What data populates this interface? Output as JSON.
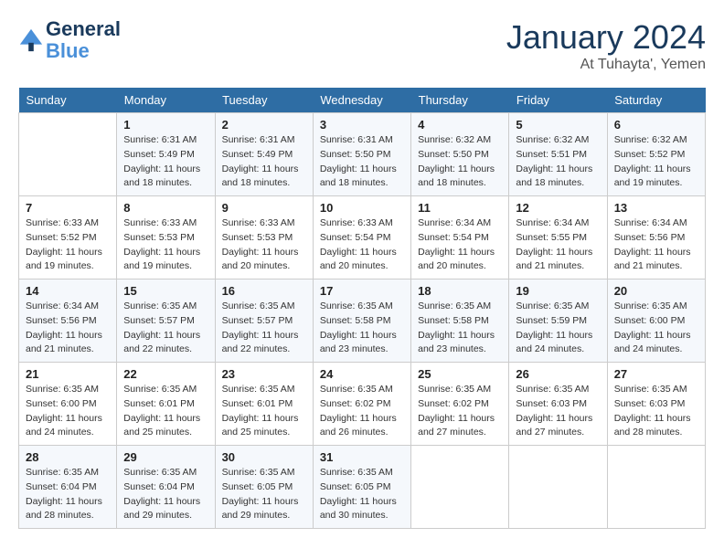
{
  "header": {
    "logo_line1": "General",
    "logo_line2": "Blue",
    "month": "January 2024",
    "location": "At Tuhayta', Yemen"
  },
  "weekdays": [
    "Sunday",
    "Monday",
    "Tuesday",
    "Wednesday",
    "Thursday",
    "Friday",
    "Saturday"
  ],
  "weeks": [
    [
      {
        "day": "",
        "info": ""
      },
      {
        "day": "1",
        "info": "Sunrise: 6:31 AM\nSunset: 5:49 PM\nDaylight: 11 hours\nand 18 minutes."
      },
      {
        "day": "2",
        "info": "Sunrise: 6:31 AM\nSunset: 5:49 PM\nDaylight: 11 hours\nand 18 minutes."
      },
      {
        "day": "3",
        "info": "Sunrise: 6:31 AM\nSunset: 5:50 PM\nDaylight: 11 hours\nand 18 minutes."
      },
      {
        "day": "4",
        "info": "Sunrise: 6:32 AM\nSunset: 5:50 PM\nDaylight: 11 hours\nand 18 minutes."
      },
      {
        "day": "5",
        "info": "Sunrise: 6:32 AM\nSunset: 5:51 PM\nDaylight: 11 hours\nand 18 minutes."
      },
      {
        "day": "6",
        "info": "Sunrise: 6:32 AM\nSunset: 5:52 PM\nDaylight: 11 hours\nand 19 minutes."
      }
    ],
    [
      {
        "day": "7",
        "info": "Sunrise: 6:33 AM\nSunset: 5:52 PM\nDaylight: 11 hours\nand 19 minutes."
      },
      {
        "day": "8",
        "info": "Sunrise: 6:33 AM\nSunset: 5:53 PM\nDaylight: 11 hours\nand 19 minutes."
      },
      {
        "day": "9",
        "info": "Sunrise: 6:33 AM\nSunset: 5:53 PM\nDaylight: 11 hours\nand 20 minutes."
      },
      {
        "day": "10",
        "info": "Sunrise: 6:33 AM\nSunset: 5:54 PM\nDaylight: 11 hours\nand 20 minutes."
      },
      {
        "day": "11",
        "info": "Sunrise: 6:34 AM\nSunset: 5:54 PM\nDaylight: 11 hours\nand 20 minutes."
      },
      {
        "day": "12",
        "info": "Sunrise: 6:34 AM\nSunset: 5:55 PM\nDaylight: 11 hours\nand 21 minutes."
      },
      {
        "day": "13",
        "info": "Sunrise: 6:34 AM\nSunset: 5:56 PM\nDaylight: 11 hours\nand 21 minutes."
      }
    ],
    [
      {
        "day": "14",
        "info": "Sunrise: 6:34 AM\nSunset: 5:56 PM\nDaylight: 11 hours\nand 21 minutes."
      },
      {
        "day": "15",
        "info": "Sunrise: 6:35 AM\nSunset: 5:57 PM\nDaylight: 11 hours\nand 22 minutes."
      },
      {
        "day": "16",
        "info": "Sunrise: 6:35 AM\nSunset: 5:57 PM\nDaylight: 11 hours\nand 22 minutes."
      },
      {
        "day": "17",
        "info": "Sunrise: 6:35 AM\nSunset: 5:58 PM\nDaylight: 11 hours\nand 23 minutes."
      },
      {
        "day": "18",
        "info": "Sunrise: 6:35 AM\nSunset: 5:58 PM\nDaylight: 11 hours\nand 23 minutes."
      },
      {
        "day": "19",
        "info": "Sunrise: 6:35 AM\nSunset: 5:59 PM\nDaylight: 11 hours\nand 24 minutes."
      },
      {
        "day": "20",
        "info": "Sunrise: 6:35 AM\nSunset: 6:00 PM\nDaylight: 11 hours\nand 24 minutes."
      }
    ],
    [
      {
        "day": "21",
        "info": "Sunrise: 6:35 AM\nSunset: 6:00 PM\nDaylight: 11 hours\nand 24 minutes."
      },
      {
        "day": "22",
        "info": "Sunrise: 6:35 AM\nSunset: 6:01 PM\nDaylight: 11 hours\nand 25 minutes."
      },
      {
        "day": "23",
        "info": "Sunrise: 6:35 AM\nSunset: 6:01 PM\nDaylight: 11 hours\nand 25 minutes."
      },
      {
        "day": "24",
        "info": "Sunrise: 6:35 AM\nSunset: 6:02 PM\nDaylight: 11 hours\nand 26 minutes."
      },
      {
        "day": "25",
        "info": "Sunrise: 6:35 AM\nSunset: 6:02 PM\nDaylight: 11 hours\nand 27 minutes."
      },
      {
        "day": "26",
        "info": "Sunrise: 6:35 AM\nSunset: 6:03 PM\nDaylight: 11 hours\nand 27 minutes."
      },
      {
        "day": "27",
        "info": "Sunrise: 6:35 AM\nSunset: 6:03 PM\nDaylight: 11 hours\nand 28 minutes."
      }
    ],
    [
      {
        "day": "28",
        "info": "Sunrise: 6:35 AM\nSunset: 6:04 PM\nDaylight: 11 hours\nand 28 minutes."
      },
      {
        "day": "29",
        "info": "Sunrise: 6:35 AM\nSunset: 6:04 PM\nDaylight: 11 hours\nand 29 minutes."
      },
      {
        "day": "30",
        "info": "Sunrise: 6:35 AM\nSunset: 6:05 PM\nDaylight: 11 hours\nand 29 minutes."
      },
      {
        "day": "31",
        "info": "Sunrise: 6:35 AM\nSunset: 6:05 PM\nDaylight: 11 hours\nand 30 minutes."
      },
      {
        "day": "",
        "info": ""
      },
      {
        "day": "",
        "info": ""
      },
      {
        "day": "",
        "info": ""
      }
    ]
  ]
}
